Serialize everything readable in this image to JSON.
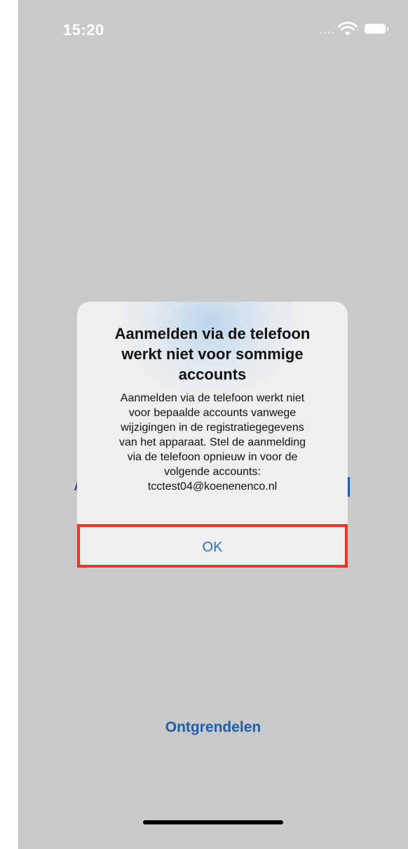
{
  "status_bar": {
    "time": "15:20",
    "wifi_icon": "wifi-icon",
    "battery_icon": "battery-icon"
  },
  "background": {
    "partial_left_text": "A",
    "unlock_label": "Ontgrendelen",
    "link_color": "#1f5fa6"
  },
  "alert": {
    "title_lines": [
      "Aanmelden via de telefoon",
      "werkt niet voor sommige",
      "accounts"
    ],
    "message_lines": [
      "Aanmelden via de telefoon werkt niet",
      "voor bepaalde accounts vanwege",
      "wijzigingen in de registratiegegevens",
      "van het apparaat. Stel de aanmelding",
      "via de telefoon opnieuw in voor de",
      "volgende accounts:",
      "tcctest04@koenenenco.nl"
    ],
    "ok_label": "OK",
    "ok_color": "#2a6fbf"
  },
  "annotation": {
    "highlight_color": "#e53a1e"
  }
}
